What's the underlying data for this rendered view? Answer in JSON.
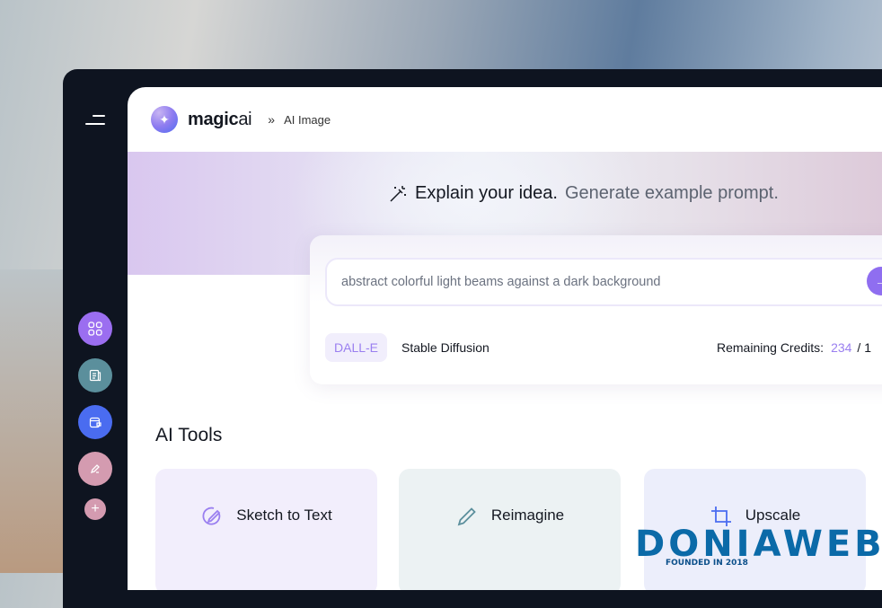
{
  "header": {
    "brand_bold": "magic",
    "brand_light": "ai",
    "breadcrumb_sep": "»",
    "breadcrumb": "AI Image"
  },
  "hero": {
    "title": "Explain your idea.",
    "subtitle": "Generate example prompt."
  },
  "prompt": {
    "value": "abstract colorful light beams against a dark background"
  },
  "engines": [
    "DALL-E",
    "Stable Diffusion"
  ],
  "credits": {
    "label": "Remaining Credits:",
    "remaining": "234",
    "total_partial": "/ 1"
  },
  "tools_section": {
    "title": "AI Tools",
    "tools": [
      {
        "label": "Sketch to Text",
        "bg": "#f2eefc"
      },
      {
        "label": "Reimagine",
        "bg": "#ecf2f3"
      },
      {
        "label": "Upscale",
        "bg": "#eceefb"
      }
    ]
  },
  "sidebar": {
    "buttons": [
      {
        "icon": "grid-icon",
        "color": "#9b6ef0"
      },
      {
        "icon": "document-icon",
        "color": "#5b8f9c"
      },
      {
        "icon": "wallet-icon",
        "color": "#4a6cf0"
      },
      {
        "icon": "pen-icon",
        "color": "#d49bb0"
      },
      {
        "icon": "plus-icon",
        "color": "#d49bb0"
      }
    ]
  },
  "watermark": {
    "text": "DONIAWEB",
    "tagline": "FOUNDED IN 2018"
  }
}
